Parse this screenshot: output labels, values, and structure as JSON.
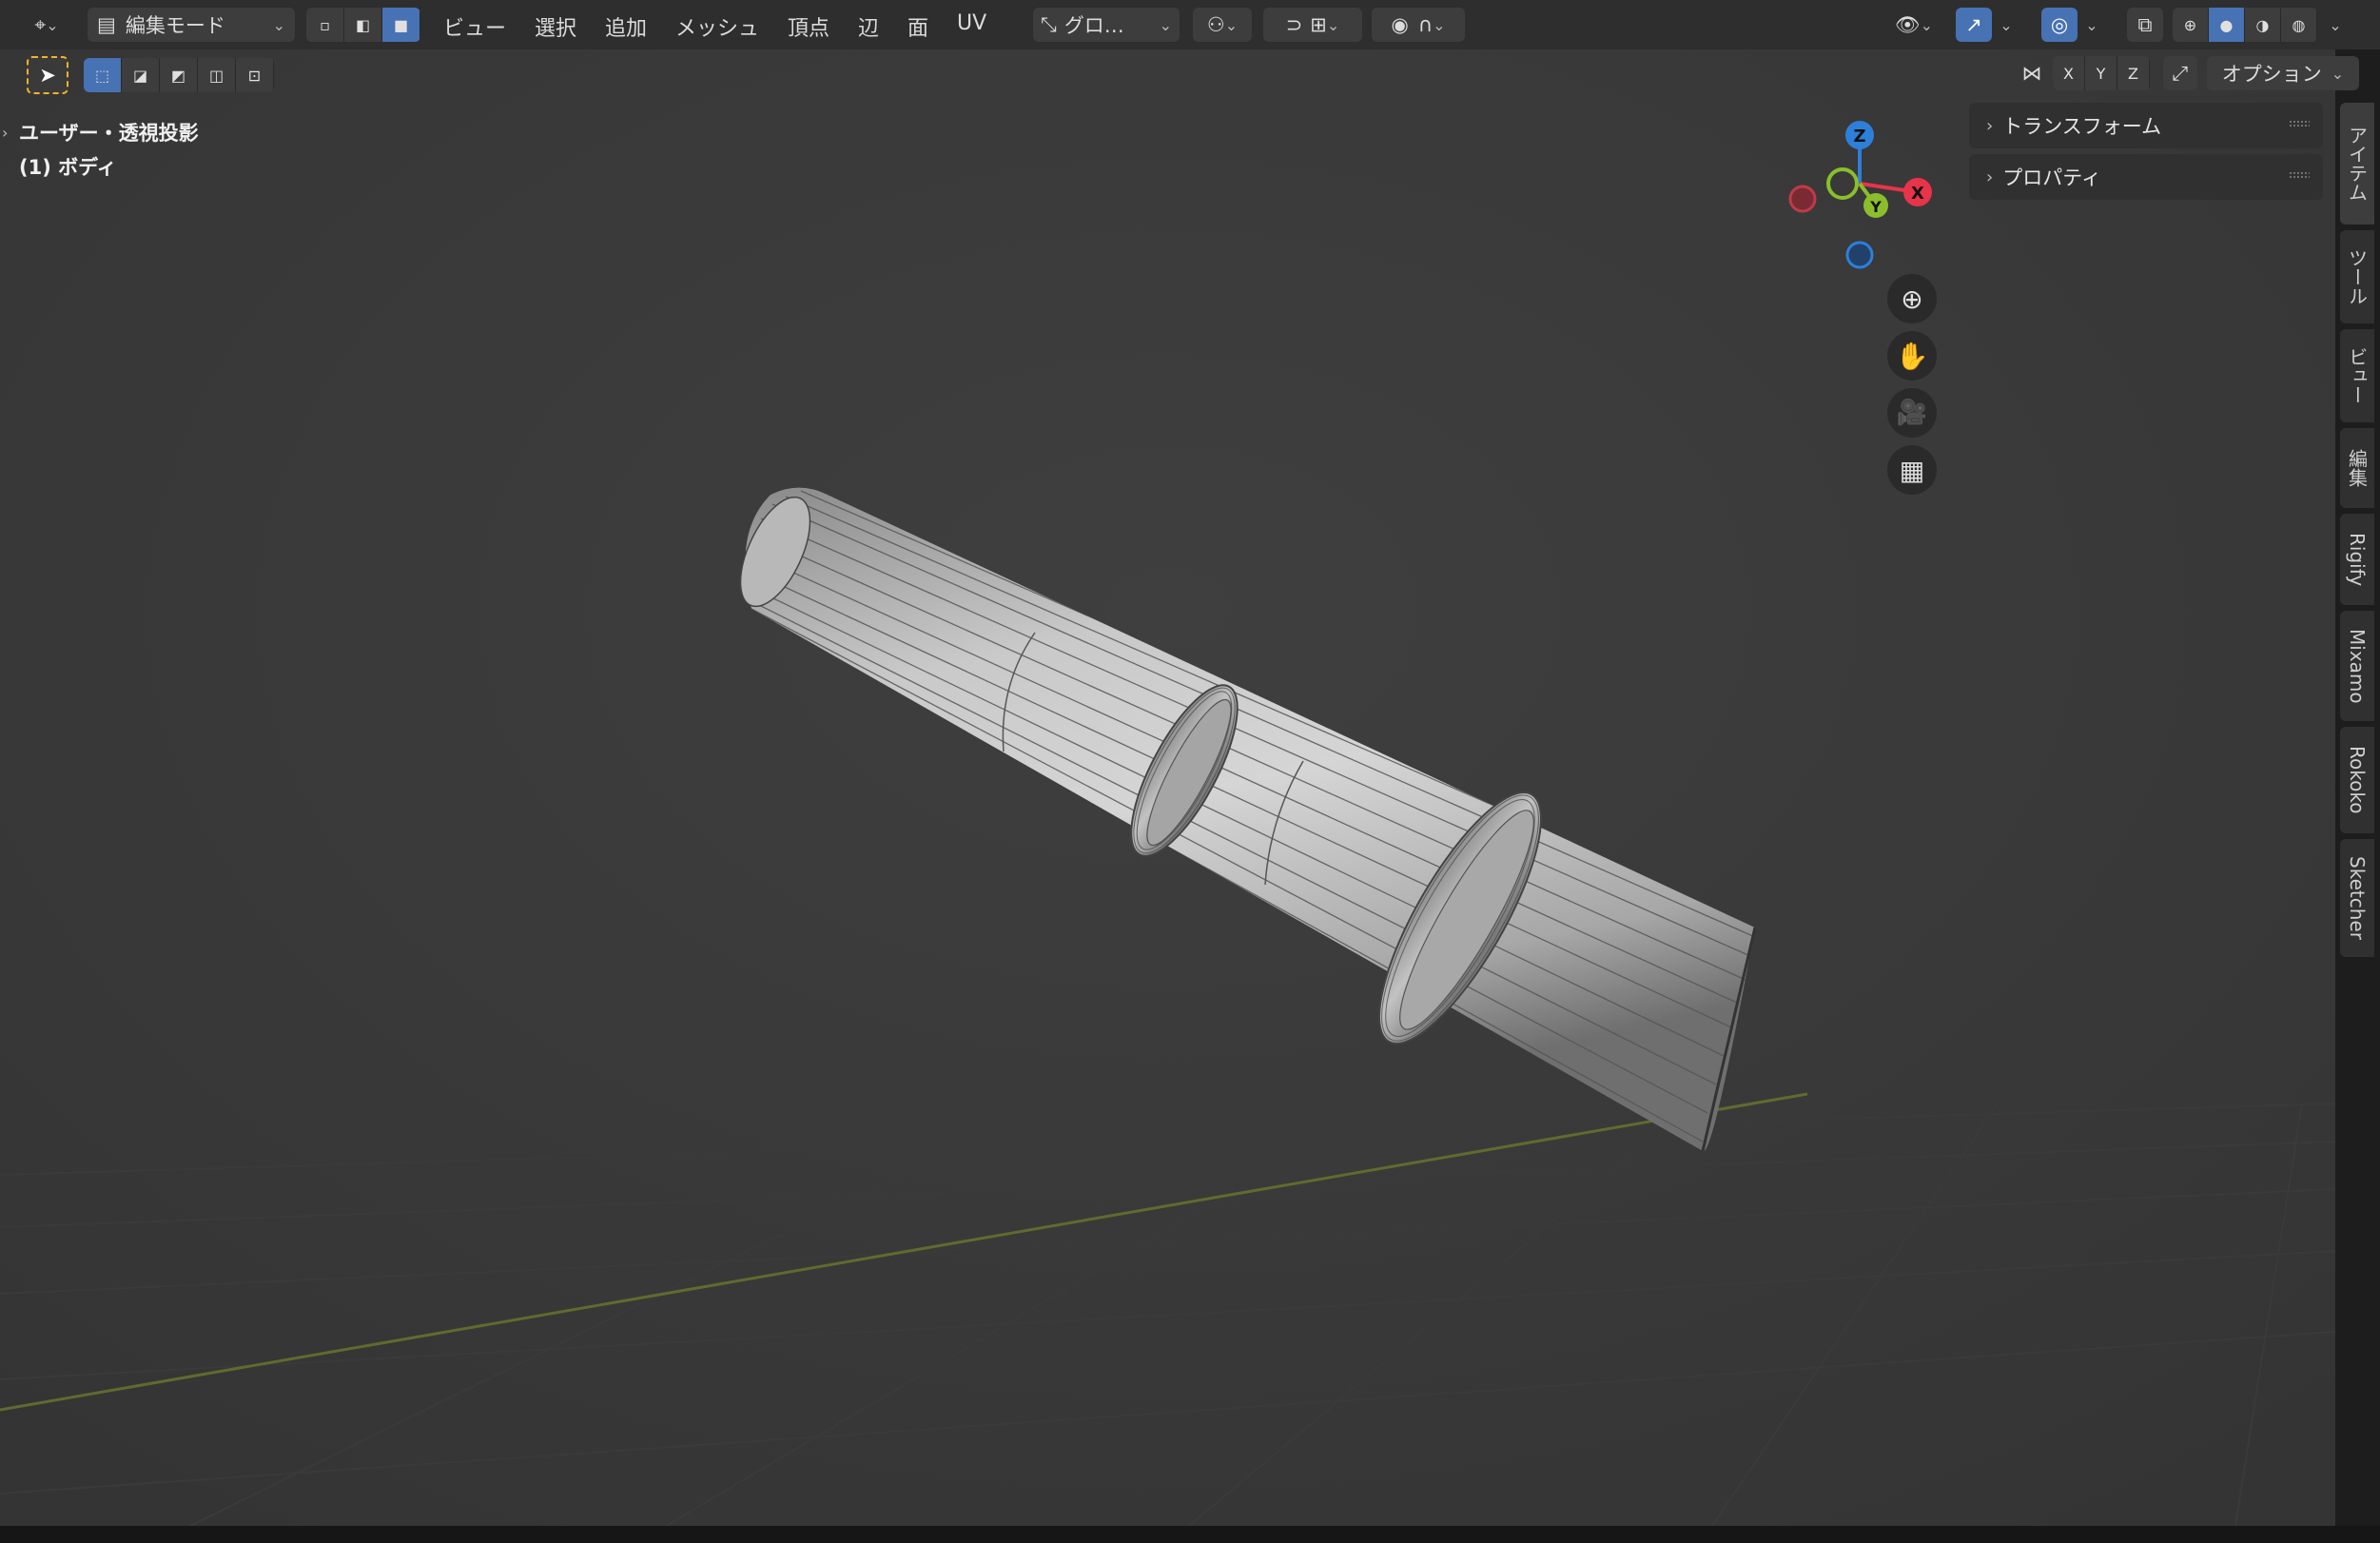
{
  "header": {
    "mode_label": "編集モード",
    "menus": [
      "ビュー",
      "選択",
      "追加",
      "メッシュ",
      "頂点",
      "辺",
      "面",
      "UV"
    ],
    "transform_orientation": "グロ…",
    "options_label": "オプション",
    "axis_x": "X",
    "axis_y": "Y",
    "axis_z": "Z"
  },
  "overlay": {
    "view_name": "ユーザー・透視投影",
    "object_name": "(1) ボディ"
  },
  "gizmo": {
    "x": "X",
    "y": "Y",
    "z": "Z"
  },
  "npanel": {
    "panels": [
      "トランスフォーム",
      "プロパティ"
    ]
  },
  "tabs": [
    "アイテム",
    "ツール",
    "ビュー",
    "編集",
    "Rigify",
    "Mixamo",
    "Rokoko",
    "Sketcher"
  ],
  "colors": {
    "accent": "#4772b3",
    "axis_x": "#e8344a",
    "axis_y": "#8bbe2c",
    "axis_z": "#2d7fd8",
    "select_box": "#f0b429"
  }
}
